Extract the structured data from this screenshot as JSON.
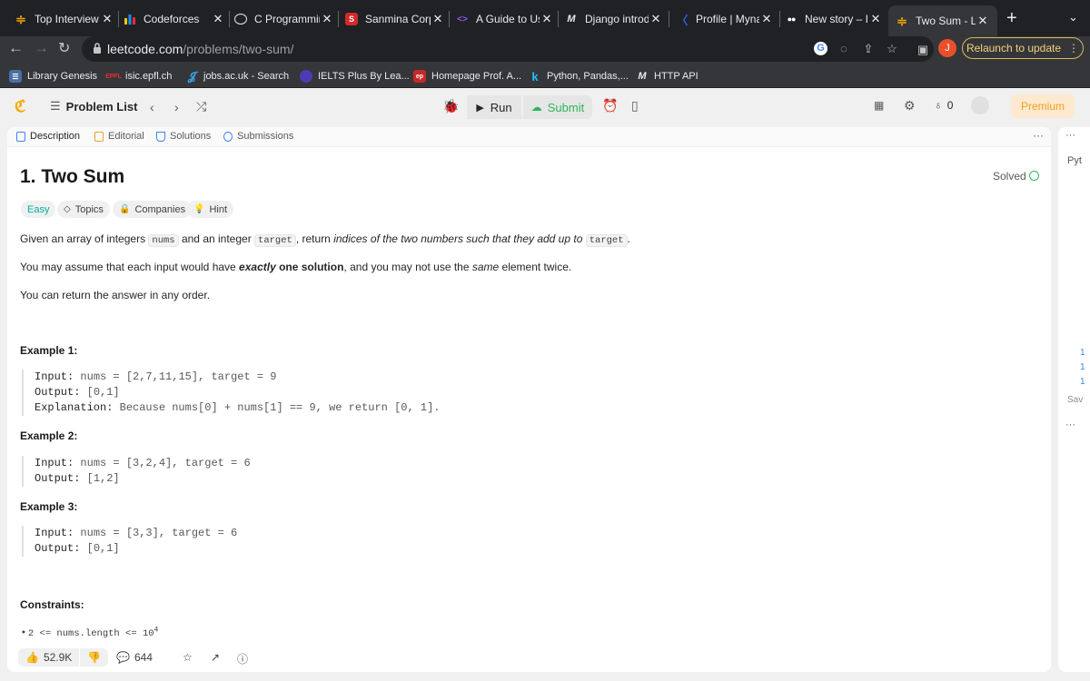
{
  "browser": {
    "tabs": [
      {
        "title": "Top Interview",
        "icon": "leetcode-icon",
        "color": "#f8a800"
      },
      {
        "title": "Codeforces",
        "icon": "codeforces-icon",
        "color": "#1890ff"
      },
      {
        "title": "C Programmir",
        "icon": "chatgpt-icon",
        "color": "#10a37f"
      },
      {
        "title": "Sanmina Corp",
        "icon": "sanmina-icon",
        "color": "#d62828"
      },
      {
        "title": "A Guide to Us",
        "icon": "code-icon",
        "color": "#8b5cf6"
      },
      {
        "title": "Django introd",
        "icon": "medium-m-icon",
        "color": "#000000"
      },
      {
        "title": "Profile | Myna",
        "icon": "mynaui-icon",
        "color": "#2563eb"
      },
      {
        "title": "New story – I",
        "icon": "medium-icon",
        "color": "#000000"
      },
      {
        "title": "Two Sum - Le",
        "icon": "leetcode-icon",
        "color": "#f8a800",
        "active": true
      }
    ],
    "url_host": "leetcode.com",
    "url_path": "/problems/two-sum/",
    "profile_initial": "J",
    "relaunch_label": "Relaunch to update",
    "bookmarks": [
      {
        "label": "Library Genesis",
        "icon": "libgen-icon"
      },
      {
        "label": "isic.epfl.ch",
        "icon": "epfl-icon"
      },
      {
        "label": "jobs.ac.uk - Search",
        "icon": "jobs-icon"
      },
      {
        "label": "IELTS Plus By Lea...",
        "icon": "ielts-icon"
      },
      {
        "label": "Homepage Prof. A...",
        "icon": "homepage-icon"
      },
      {
        "label": "Python, Pandas,...",
        "icon": "kaggle-k-icon"
      },
      {
        "label": "HTTP API",
        "icon": "medium-m-icon"
      }
    ]
  },
  "app": {
    "problem_list_label": "Problem List",
    "run_label": "Run",
    "submit_label": "Submit",
    "notification_count": "0",
    "premium_label": "Premium",
    "panel_tabs": [
      "Description",
      "Editorial",
      "Solutions",
      "Submissions"
    ],
    "right_panel_snippet": "Pyt",
    "right_panel_save": "Sav"
  },
  "problem": {
    "title": "1. Two Sum",
    "status": "Solved",
    "difficulty": "Easy",
    "chips": [
      "Topics",
      "Companies",
      "Hint"
    ],
    "desc1_a": "Given an array of integers ",
    "desc1_code1": "nums",
    "desc1_b": " and an integer ",
    "desc1_code2": "target",
    "desc1_c": ", return ",
    "desc1_em": "indices of the two numbers such that they add up to",
    "desc1_code3": "target",
    "desc1_end": ".",
    "desc2_a": "You may assume that each input would have ",
    "desc2_strong_em": "exactly",
    "desc2_strong": " one solution",
    "desc2_b": ", and you may not use the ",
    "desc2_em": "same",
    "desc2_c": " element twice.",
    "desc3": "You can return the answer in any order.",
    "examples": [
      {
        "heading": "Example 1:",
        "input": "nums = [2,7,11,15], target = 9",
        "output": "[0,1]",
        "explanation": "Because nums[0] + nums[1] == 9, we return [0, 1]."
      },
      {
        "heading": "Example 2:",
        "input": "nums = [3,2,4], target = 6",
        "output": "[1,2]"
      },
      {
        "heading": "Example 3:",
        "input": "nums = [3,3], target = 6",
        "output": "[0,1]"
      }
    ],
    "labels": {
      "input": "Input:",
      "output": "Output:",
      "explanation": "Explanation:"
    },
    "constraints_heading": "Constraints:",
    "constraint_1": "2 <= nums.length <= 10",
    "constraint_1_sup": "4",
    "likes": "52.9K",
    "comments": "644"
  }
}
